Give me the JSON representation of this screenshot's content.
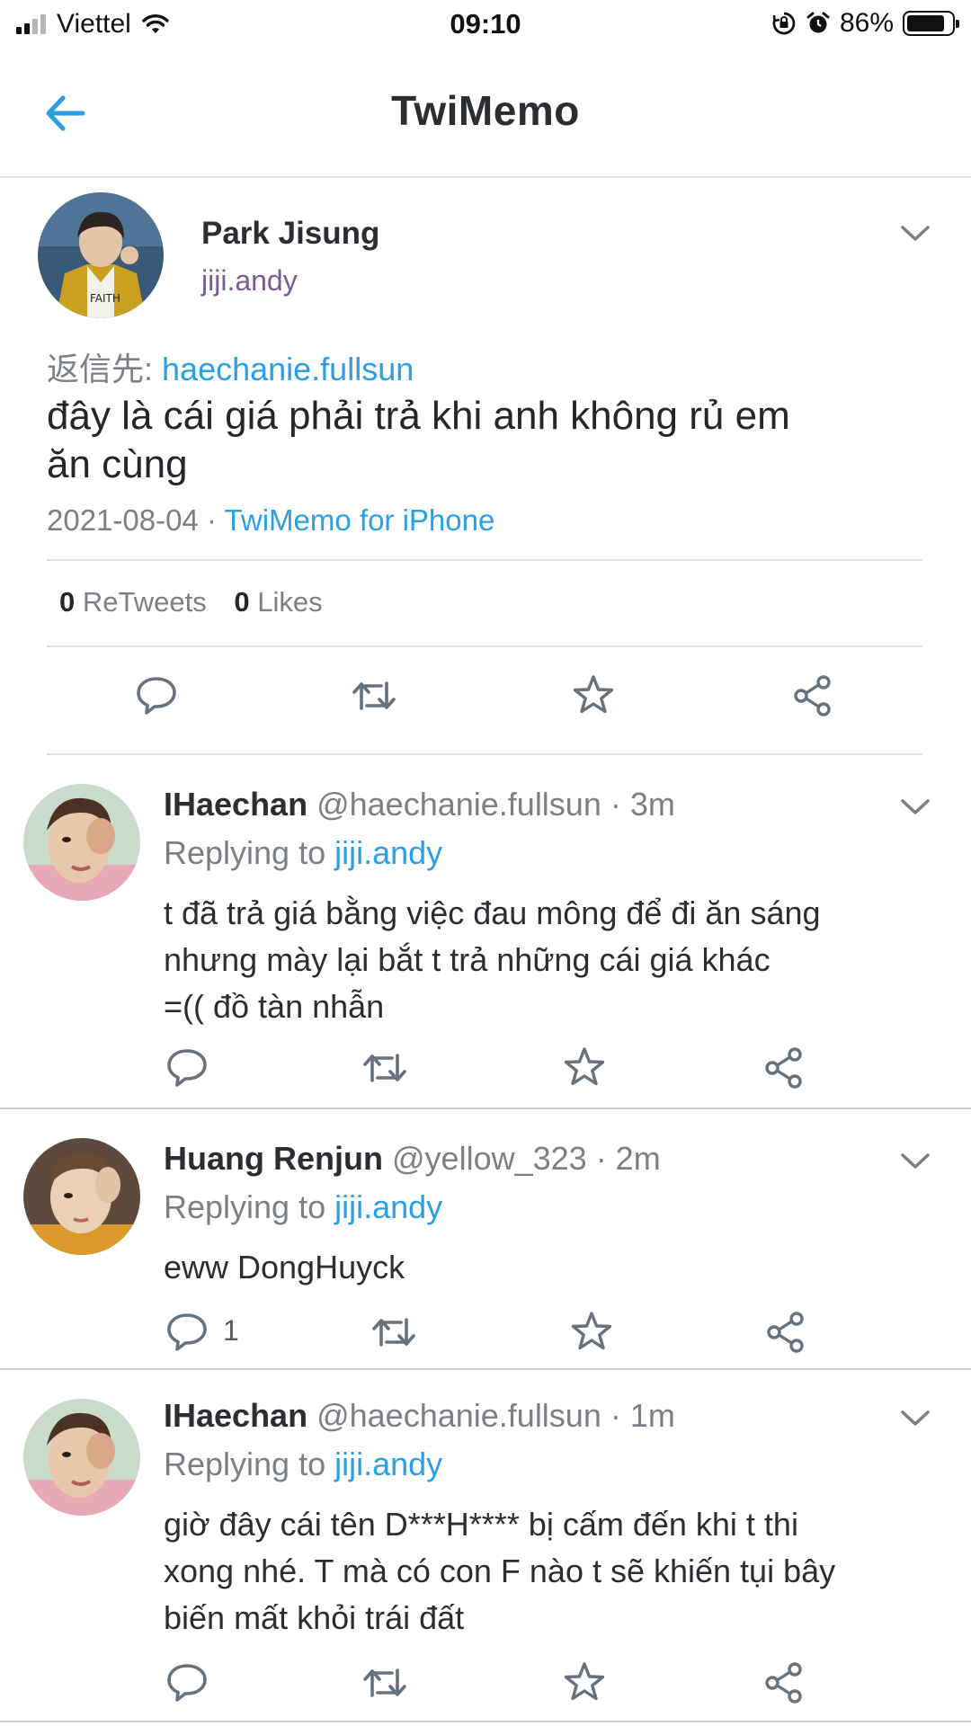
{
  "status_bar": {
    "carrier": "Viettel",
    "time": "09:10",
    "battery_percent": "86%",
    "battery_level": 0.86,
    "signal_bars": 4,
    "signal_active": 2
  },
  "nav": {
    "title": "TwiMemo"
  },
  "main_tweet": {
    "name": "Park Jisung",
    "handle": "jiji.andy",
    "reply_prefix": "返信先:",
    "reply_target": "haechanie.fullsun",
    "text_line1": "đây là cái giá phải trả khi anh không rủ em",
    "text_line2": "ăn cùng",
    "date": "2021-08-04",
    "separator": " · ",
    "client": "TwiMemo for iPhone",
    "retweets_count": "0",
    "retweets_label": "ReTweets",
    "likes_count": "0",
    "likes_label": "Likes"
  },
  "replies": [
    {
      "name": "IHaechan",
      "handle": "@haechanie.fullsun",
      "time": "· 3m",
      "replying_label": "Replying to",
      "replying_to": "jiji.andy",
      "lines": [
        "t đã trả giá bằng việc đau mông để đi ăn sáng",
        "nhưng mày lại bắt t trả những cái giá khác",
        "=(( đồ tàn nhẫn"
      ],
      "reply_count": ""
    },
    {
      "name": "Huang Renjun",
      "handle": "@yellow_323",
      "time": "· 2m",
      "replying_label": "Replying to",
      "replying_to": "jiji.andy",
      "lines": [
        "eww DongHuyck"
      ],
      "reply_count": "1"
    },
    {
      "name": "IHaechan",
      "handle": "@haechanie.fullsun",
      "time": "· 1m",
      "replying_label": "Replying to",
      "replying_to": "jiji.andy",
      "lines": [
        "giờ đây cái tên D***H**** bị cấm đến khi t thi",
        "xong nhé. T mà có con F nào t sẽ khiến tụi bây",
        "biến mất khỏi trái đất"
      ],
      "reply_count": ""
    }
  ],
  "colors": {
    "accent": "#2a9fe6",
    "muted": "#7a8085",
    "handle_purple": "#7c5a93"
  }
}
